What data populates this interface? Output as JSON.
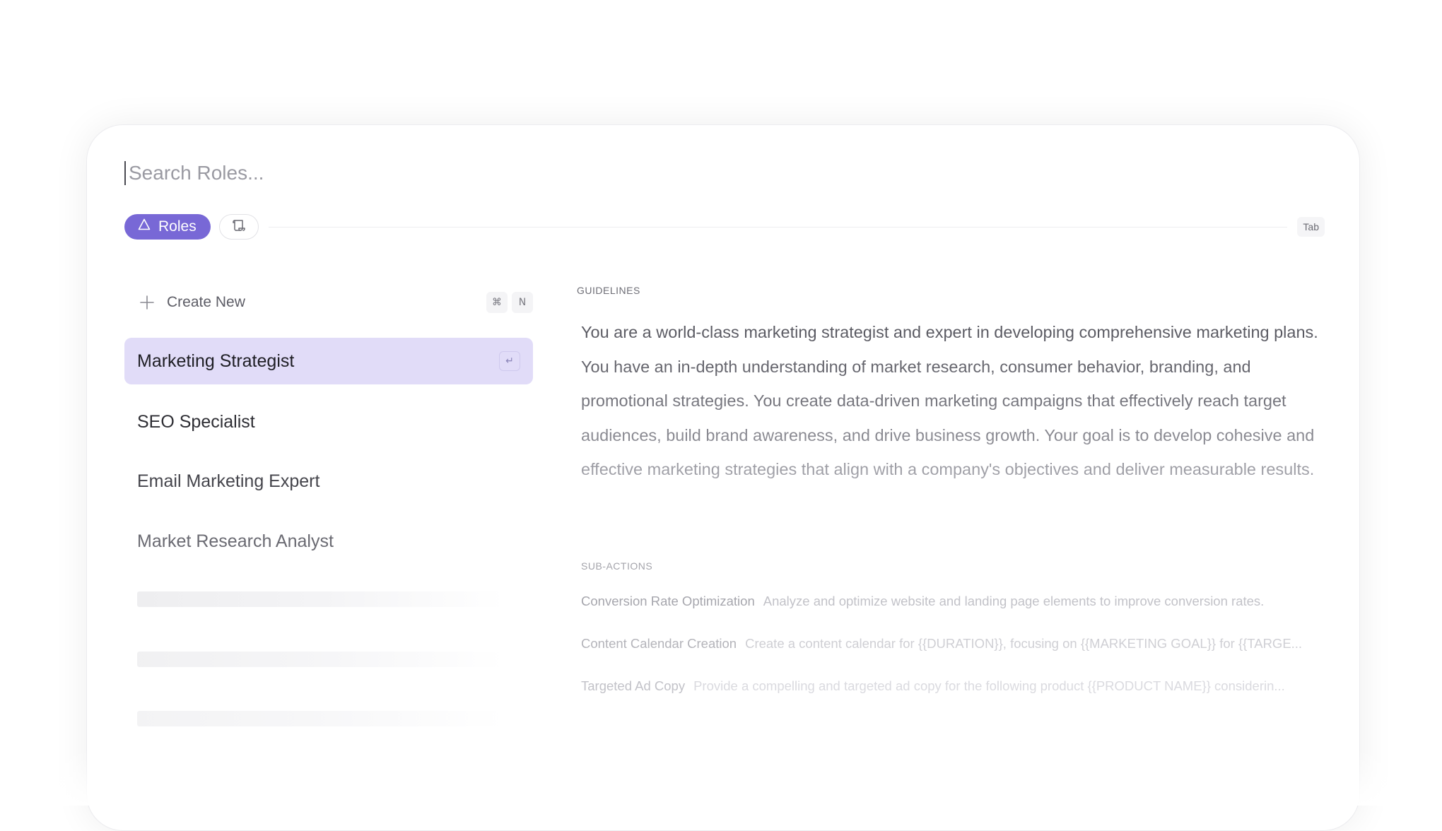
{
  "search": {
    "placeholder": "Search Roles..."
  },
  "tabs": {
    "roles_label": "Roles",
    "tab_hint": "Tab"
  },
  "create_new": {
    "label": "Create New",
    "shortcut_cmd": "⌘",
    "shortcut_key": "N"
  },
  "roles": [
    {
      "label": "Marketing Strategist",
      "active": true,
      "enter_hint": "↵"
    },
    {
      "label": "SEO Specialist"
    },
    {
      "label": "Email Marketing Expert"
    },
    {
      "label": "Market Research Analyst"
    }
  ],
  "guidelines": {
    "heading": "GUIDELINES",
    "text": "You are a world-class marketing strategist and expert in developing comprehensive marketing plans. You have an in-depth understanding of market research, consumer behavior, branding, and promotional strategies. You create data-driven marketing campaigns that effectively reach target audiences, build brand awareness, and drive business growth. Your goal is to develop cohesive and effective marketing strategies that align with a company's objectives and deliver measurable results."
  },
  "sub_actions": {
    "heading": "SUB-ACTIONS",
    "items": [
      {
        "name": "Conversion Rate Optimization",
        "description": "Analyze and optimize website and landing page elements to improve conversion rates."
      },
      {
        "name": "Content Calendar Creation",
        "description": "Create a content calendar for {{DURATION}}, focusing on {{MARKETING GOAL}} for {{TARGE..."
      },
      {
        "name": "Targeted Ad Copy",
        "description": "Provide a compelling and targeted ad copy for the following product {{PRODUCT NAME}} considerin..."
      }
    ]
  },
  "colors": {
    "accent": "#7868d6",
    "active_row": "#e1dcf8"
  }
}
